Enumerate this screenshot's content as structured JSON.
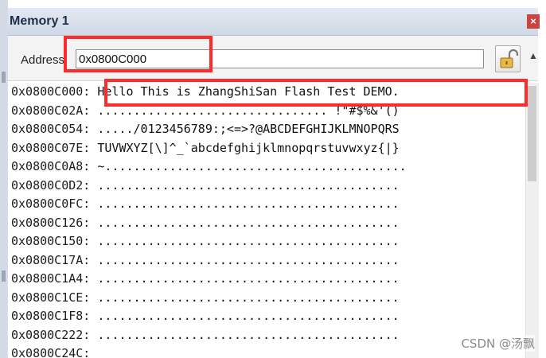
{
  "window": {
    "title": "Memory 1",
    "close_glyph": "×"
  },
  "toolbar": {
    "address_label": "Address",
    "address_value": "0x0800C000",
    "lock_icon": "unlocked-padlock-icon",
    "scroll_up_glyph": "▲"
  },
  "rows": [
    {
      "addr": "0x0800C000:",
      "data": " Hello This is ZhangShiSan Flash Test DEMO."
    },
    {
      "addr": "0x0800C02A:",
      "data": " ................................ !\"#$%&'()"
    },
    {
      "addr": "0x0800C054:",
      "data": " ...../0123456789:;<=>?@ABCDEFGHIJKLMNOPQRS"
    },
    {
      "addr": "0x0800C07E:",
      "data": " TUVWXYZ[\\]^_`abcdefghijklmnopqrstuvwxyz{|}"
    },
    {
      "addr": "0x0800C0A8:",
      "data": " ~.........................................."
    },
    {
      "addr": "0x0800C0D2:",
      "data": " .........................................."
    },
    {
      "addr": "0x0800C0FC:",
      "data": " .........................................."
    },
    {
      "addr": "0x0800C126:",
      "data": " .........................................."
    },
    {
      "addr": "0x0800C150:",
      "data": " .........................................."
    },
    {
      "addr": "0x0800C17A:",
      "data": " .........................................."
    },
    {
      "addr": "0x0800C1A4:",
      "data": " .........................................."
    },
    {
      "addr": "0x0800C1CE:",
      "data": " .........................................."
    },
    {
      "addr": "0x0800C1F8:",
      "data": " .........................................."
    },
    {
      "addr": "0x0800C222:",
      "data": " .........................................."
    },
    {
      "addr": "0x0800C24C:",
      "data": ""
    }
  ],
  "watermark": "CSDN @汤飘",
  "colors": {
    "highlight": "#ff2b2b",
    "title_bar": "#d9e1ec",
    "close_button": "#c8463f"
  }
}
